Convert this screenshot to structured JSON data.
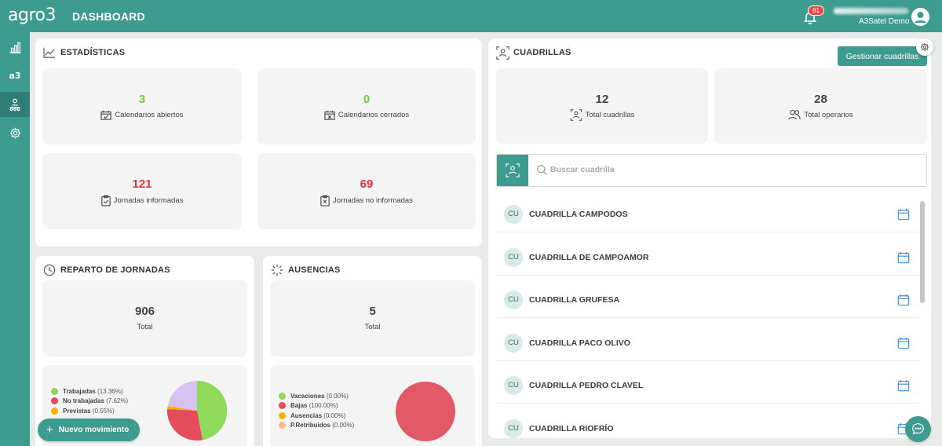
{
  "app": {
    "logo": "agro3",
    "title": "DASHBOARD"
  },
  "header": {
    "notification_count": "81",
    "user_org": "A3Satel Demo"
  },
  "sidebar": {
    "items": [
      {
        "icon": "chart-icon"
      },
      {
        "label": "a3"
      },
      {
        "icon": "team-icon"
      },
      {
        "icon": "gear-icon"
      }
    ]
  },
  "estadisticas": {
    "title": "ESTADÍSTICAS",
    "cards": [
      {
        "value": "3",
        "label": "Calendarios abiertos",
        "color": "#7ac943"
      },
      {
        "value": "0",
        "label": "Calendarios cerrados",
        "color": "#7ac943"
      },
      {
        "value": "121",
        "label": "Jornadas informadas",
        "color": "#e0303a"
      },
      {
        "value": "69",
        "label": "Jornadas no informadas",
        "color": "#e0303a"
      }
    ]
  },
  "reparto": {
    "title": "REPARTO DE JORNADAS",
    "total_value": "906",
    "total_label": "Total",
    "legend": [
      {
        "name": "Trabajadas",
        "pct": "(13.36%)",
        "color": "#8ed85a"
      },
      {
        "name": "No trabajadas",
        "pct": "(7.62%)",
        "color": "#e44b5b"
      },
      {
        "name": "Previstas",
        "pct": "(0.55%)",
        "color": "#f5b000"
      }
    ]
  },
  "ausencias": {
    "title": "AUSENCIAS",
    "total_value": "5",
    "total_label": "Total",
    "legend": [
      {
        "name": "Vacaciones",
        "pct": "(0.00%)",
        "color": "#8ed85a"
      },
      {
        "name": "Bajas",
        "pct": "(100.00%)",
        "color": "#e44b5b"
      },
      {
        "name": "Ausencias",
        "pct": "(0.00%)",
        "color": "#f5b000"
      },
      {
        "name": "P.Retribuidos",
        "pct": "(0.00%)",
        "color": "#f7b98f"
      }
    ]
  },
  "cuadrillas": {
    "title": "CUADRILLAS",
    "manage_button": "Gestionar cuadrillas",
    "total_cuadrillas_value": "12",
    "total_cuadrillas_label": "Total cuadrillas",
    "total_operarios_value": "28",
    "total_operarios_label": "Total operarios",
    "search_placeholder": "Buscar cuadrilla",
    "items": [
      {
        "initials": "CU",
        "name": "CUADRILLA CAMPODOS"
      },
      {
        "initials": "CU",
        "name": "CUADRILLA DE CAMPOAMOR"
      },
      {
        "initials": "CU",
        "name": "CUADRILLA GRUFESA"
      },
      {
        "initials": "CU",
        "name": "CUADRILLA PACO OLIVO"
      },
      {
        "initials": "CU",
        "name": "CUADRILLA PEDRO CLAVEL"
      },
      {
        "initials": "CU",
        "name": "CUADRILLA RIOFRÍO"
      }
    ]
  },
  "fab": {
    "label": "Nuevo movimiento"
  }
}
